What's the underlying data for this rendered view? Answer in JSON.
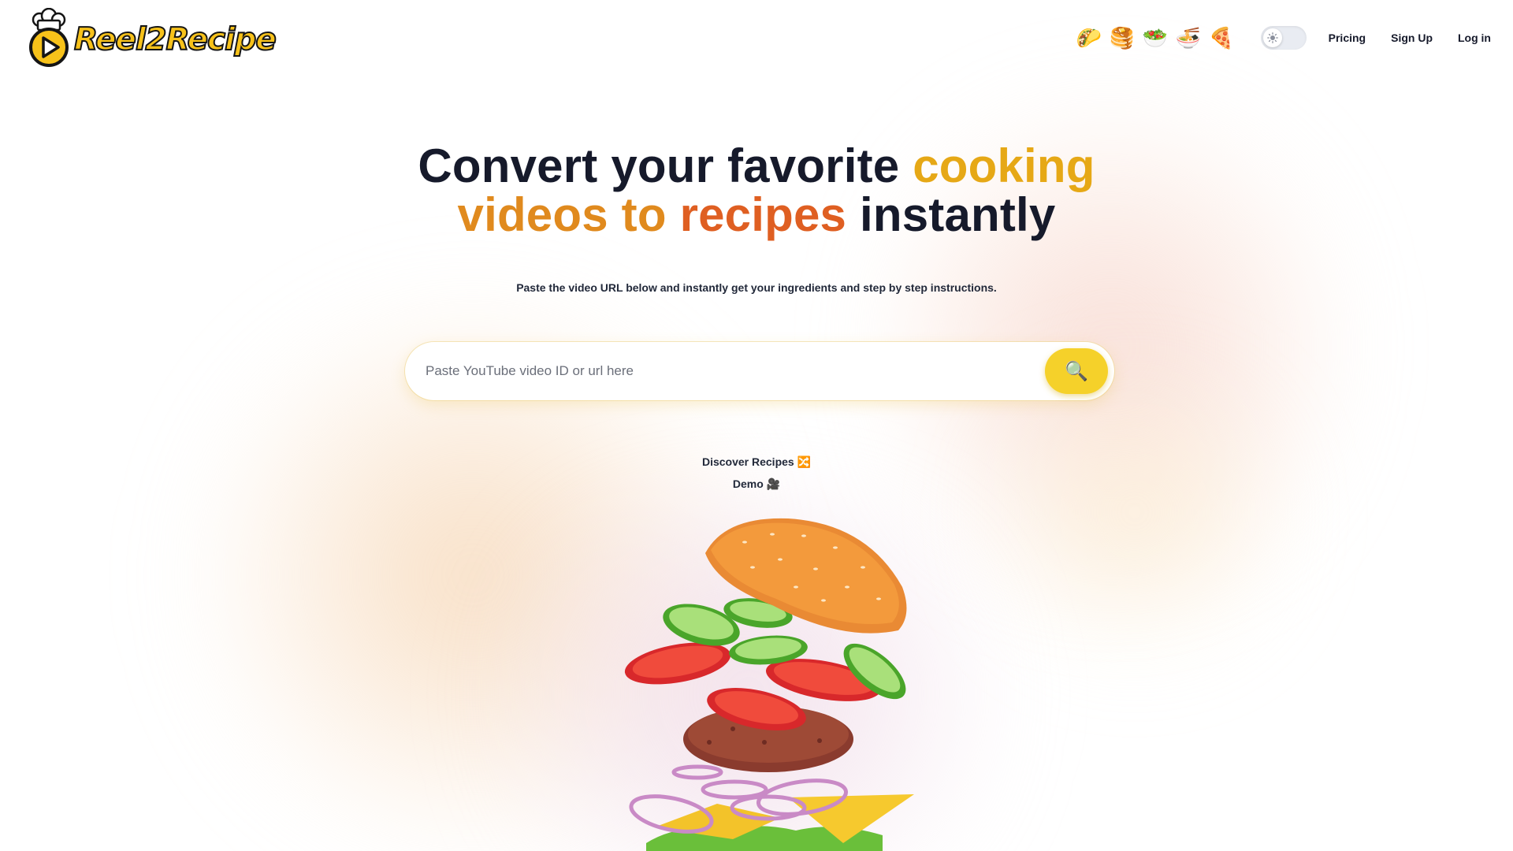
{
  "brand": {
    "name": "Reel2Recipe"
  },
  "nav": {
    "food_icons": [
      {
        "glyph": "🌮",
        "name": "taco-icon"
      },
      {
        "glyph": "🥞",
        "name": "pancakes-icon"
      },
      {
        "glyph": "🥗",
        "name": "salad-icon"
      },
      {
        "glyph": "🍜",
        "name": "noodles-icon"
      },
      {
        "glyph": "🍕",
        "name": "pizza-icon"
      }
    ],
    "theme_toggle": {
      "state": "light",
      "icon": "sun-icon"
    },
    "links": {
      "pricing": "Pricing",
      "signup": "Sign Up",
      "login": "Log in"
    }
  },
  "hero": {
    "title": {
      "part1": "Convert your favorite ",
      "part2": "cooking",
      "part3": "videos to ",
      "part4": "recipes",
      "part5": " instantly"
    },
    "subtitle": "Paste the video URL below and instantly get your ingredients and step by step instructions."
  },
  "search": {
    "placeholder": "Paste YouTube video ID or url here",
    "value": "",
    "button_icon": "🔍"
  },
  "links": {
    "discover": "Discover Recipes 🔀",
    "demo": "Demo 🎥"
  },
  "colors": {
    "brand_yellow": "#f5d12a",
    "title_dark": "#161a2b",
    "highlight_gold": "#e6a816",
    "highlight_orange": "#e08a1e",
    "highlight_red": "#df5f22"
  }
}
